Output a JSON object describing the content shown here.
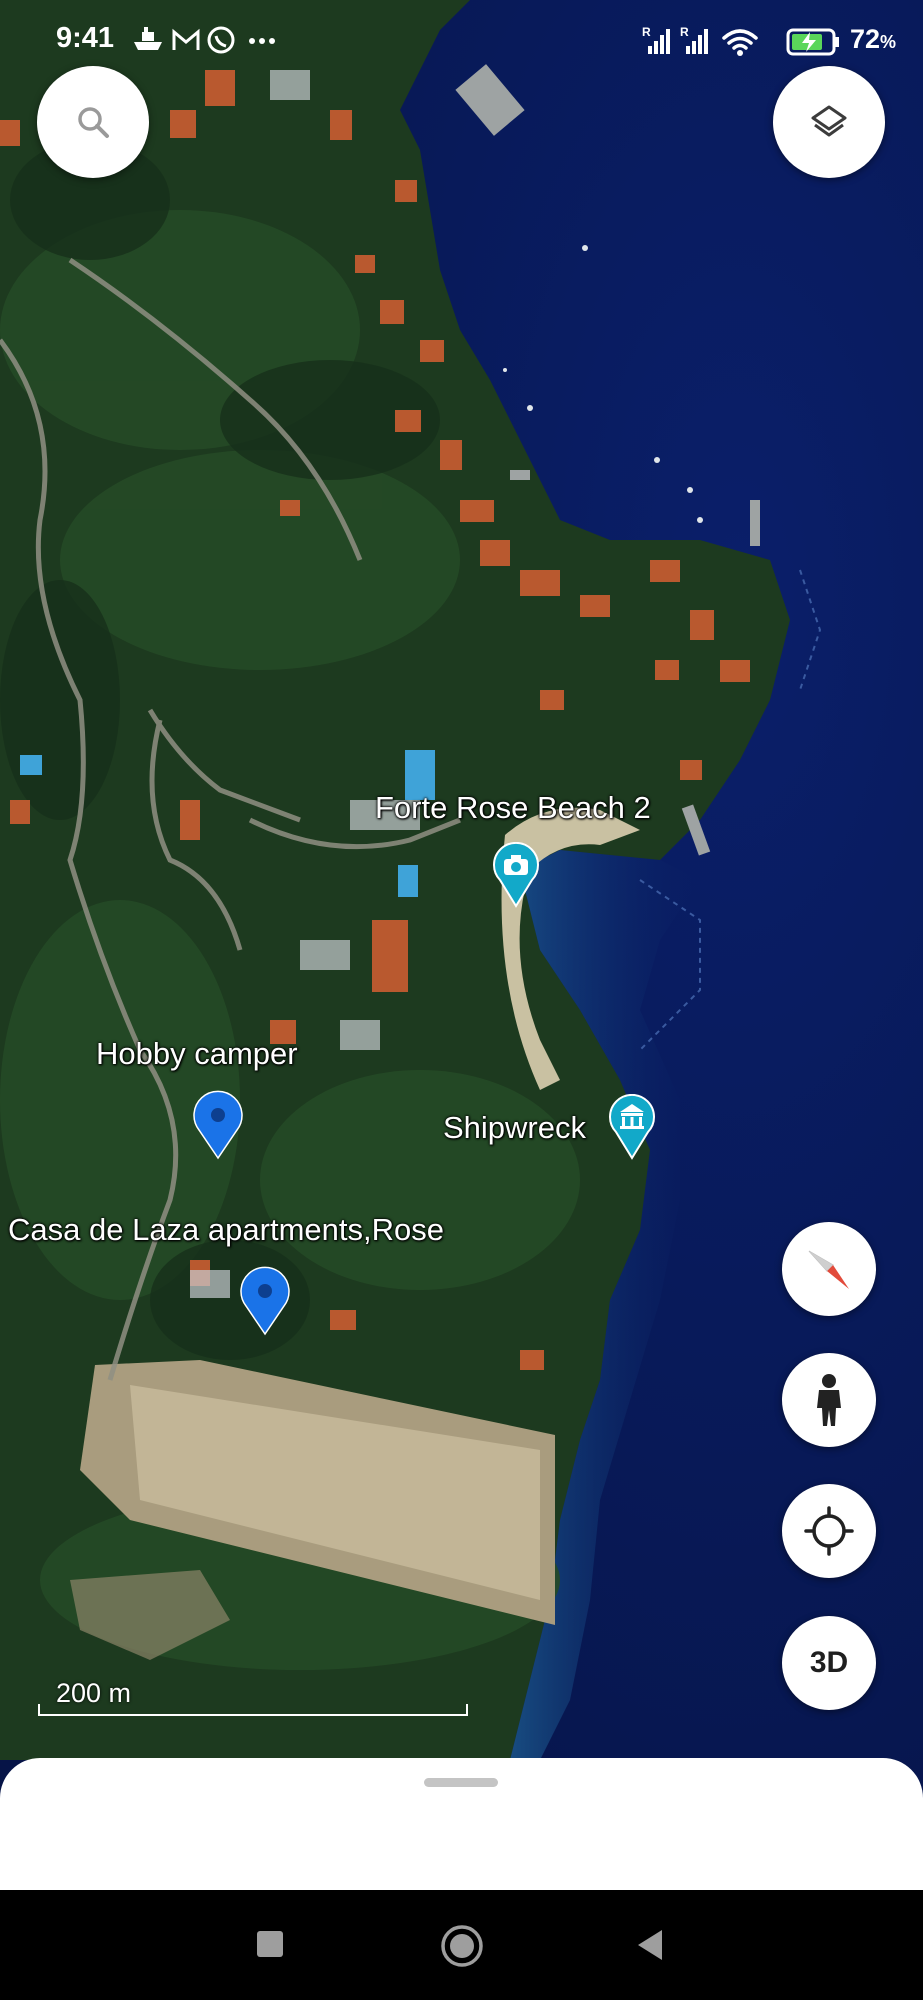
{
  "status_bar": {
    "time": "9:41",
    "battery_percent": "72",
    "battery_percent_symbol": "%",
    "signal_1_label": "R",
    "signal_2_label": "R",
    "notification_icons": [
      "boat-icon",
      "gmail-icon",
      "viber-icon",
      "more-icon"
    ],
    "system_icons": [
      "signal-icon",
      "signal-icon",
      "wifi-icon",
      "battery-charging-icon"
    ]
  },
  "map": {
    "places": {
      "forte_rose_beach": {
        "label": "Forte Rose Beach 2",
        "icon": "camera-icon",
        "color": "#12a9c9"
      },
      "shipwreck": {
        "label": "Shipwreck",
        "icon": "museum-icon",
        "color": "#12a9c9"
      },
      "hobby_camper": {
        "label": "Hobby camper",
        "icon": "map-pin-icon",
        "color": "#1a73e8"
      },
      "casa_de_laza": {
        "label": "Casa de Laza apartments,Rose",
        "icon": "map-pin-icon",
        "color": "#1a73e8"
      }
    },
    "scale": {
      "label": "200 m"
    }
  },
  "controls": {
    "search_icon": "search-icon",
    "layers_icon": "layers-icon",
    "compass_icon": "compass-icon",
    "street_view_icon": "pegman-icon",
    "my_location_icon": "my-location-icon",
    "three_d_label": "3D"
  },
  "bottom_sheet": {
    "handle": "drag-handle"
  },
  "nav_bar": {
    "buttons": [
      "recents-icon",
      "home-icon",
      "back-icon"
    ]
  }
}
